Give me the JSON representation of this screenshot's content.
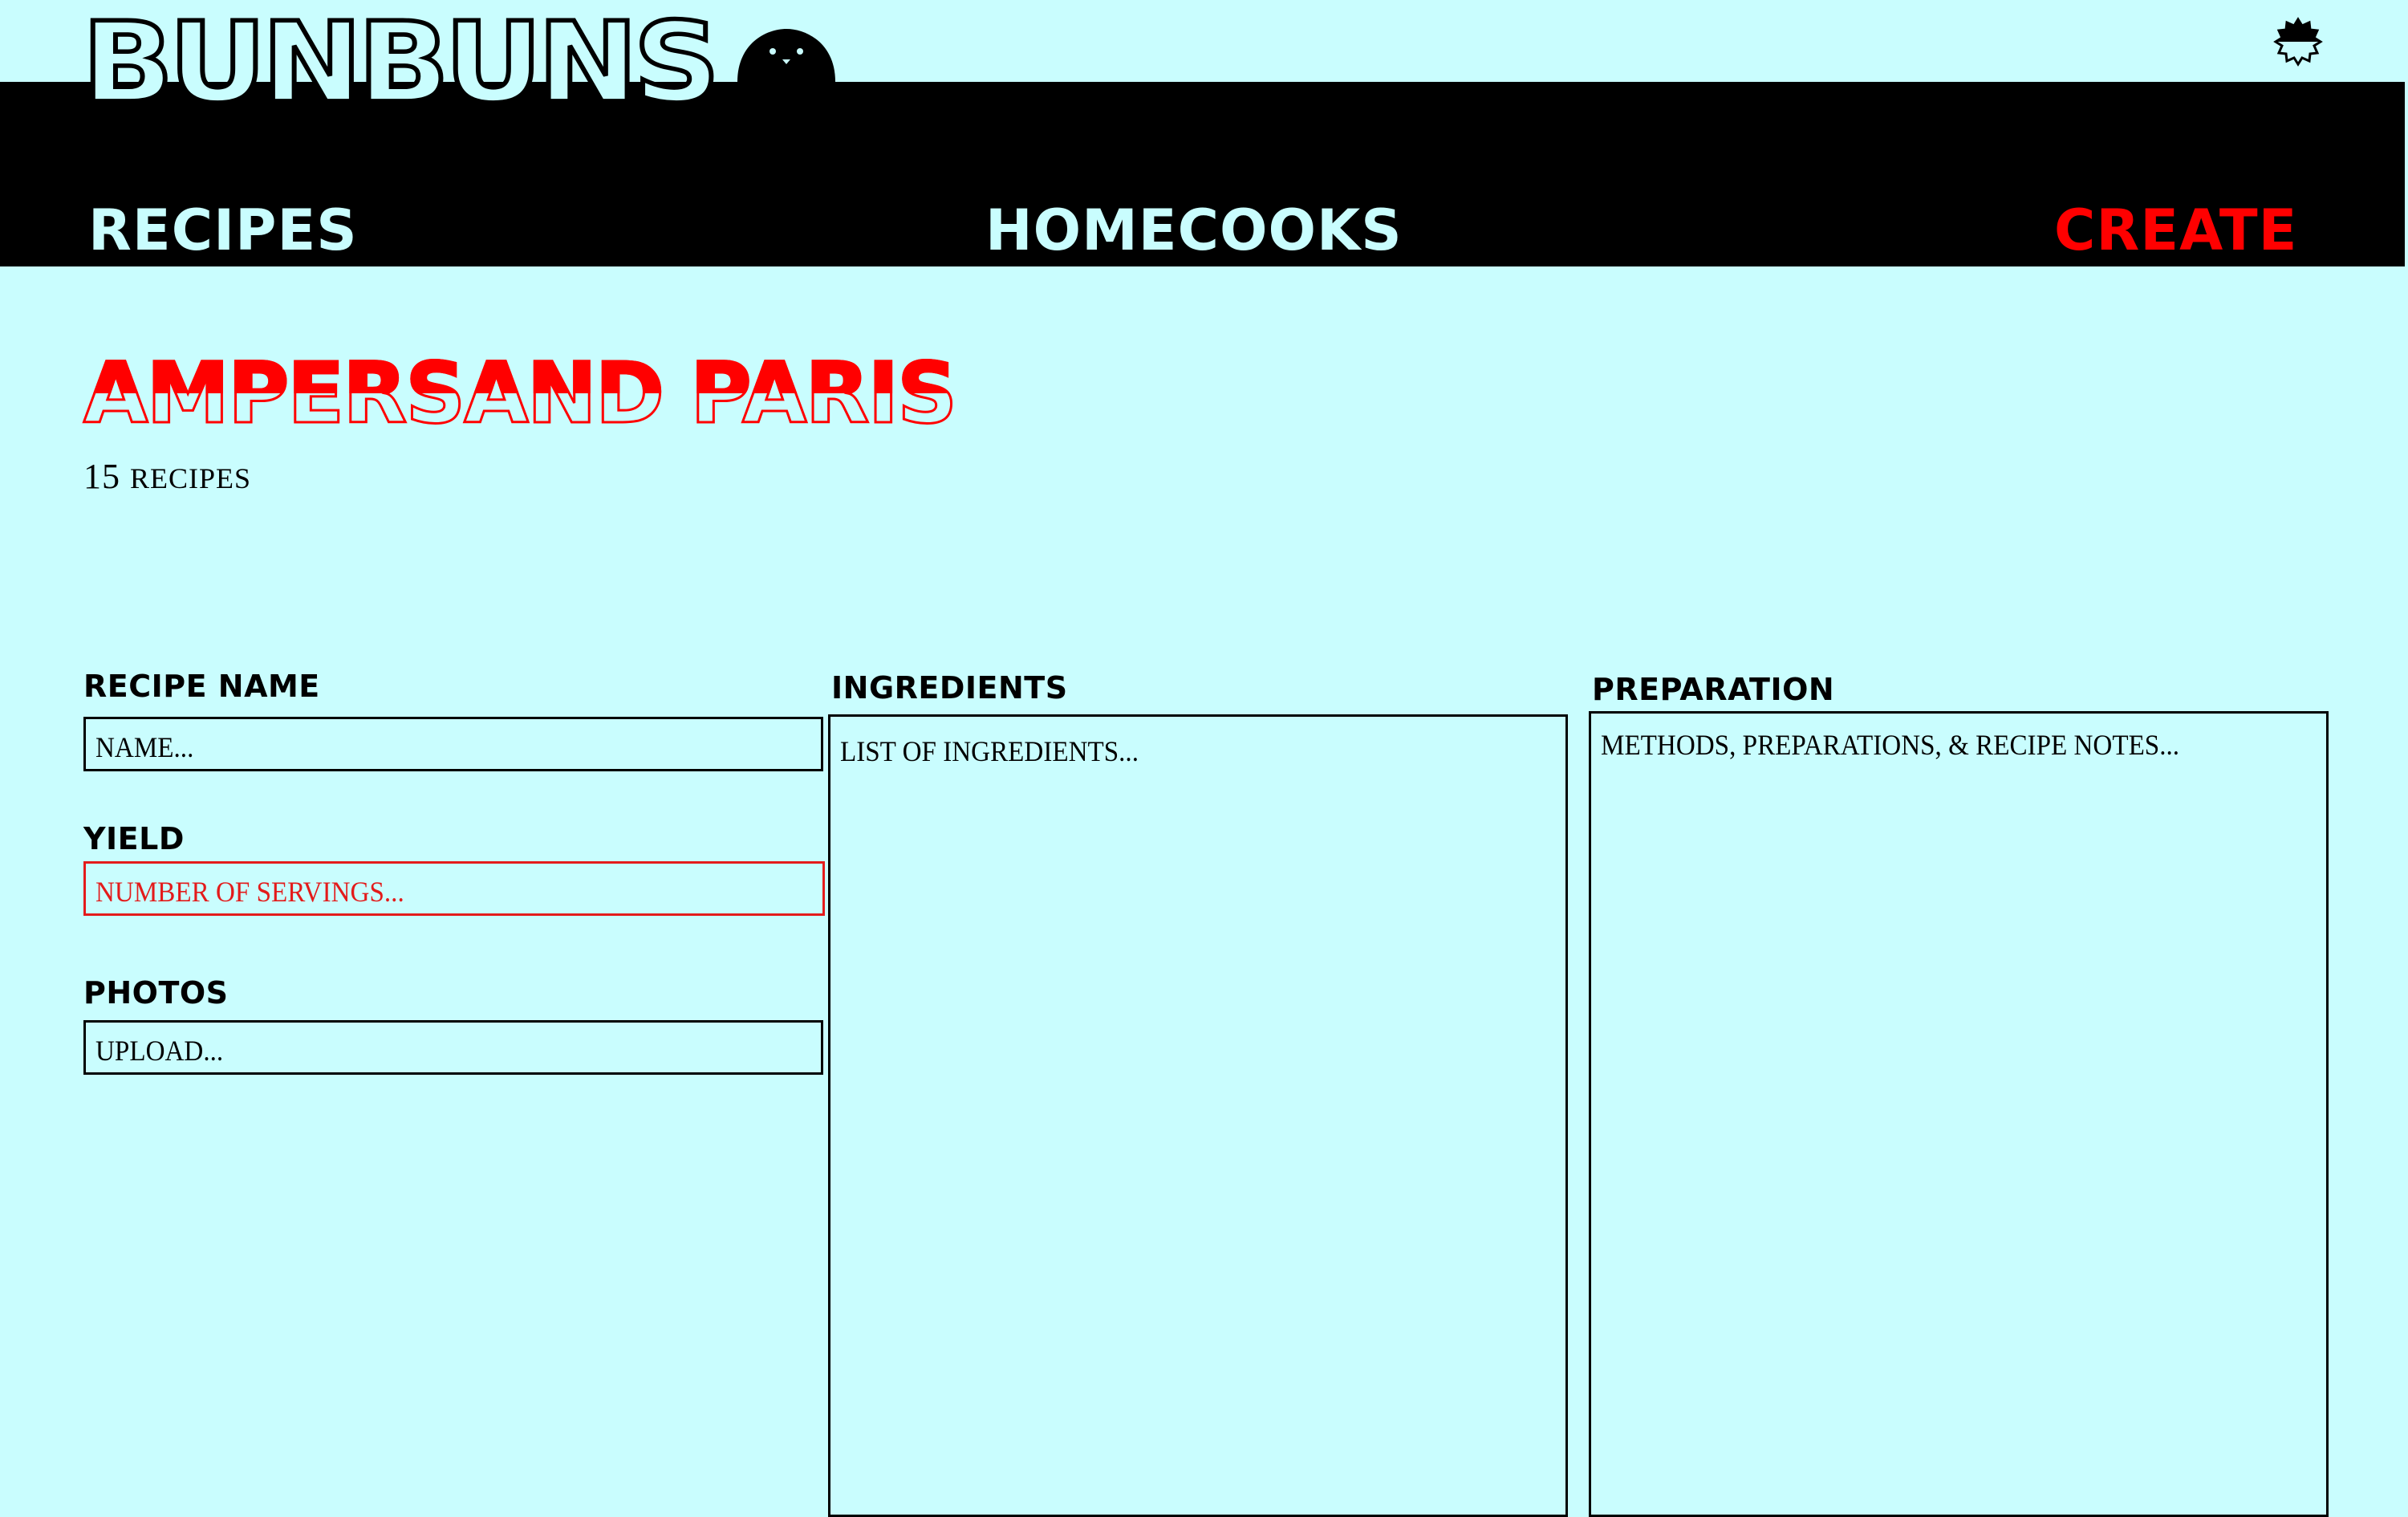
{
  "brand": {
    "name": "BUNBUNS"
  },
  "nav": {
    "recipes": "RECIPES",
    "homecooks": "HOMECOOKS",
    "create": "CREATE"
  },
  "profile": {
    "name": "AMPERSAND PARIS",
    "recipe_count": "15",
    "recipe_count_unit": "RECIPES"
  },
  "form": {
    "recipe_name": {
      "label": "RECIPE NAME",
      "placeholder": "NAME..."
    },
    "yield": {
      "label": "YIELD",
      "placeholder": "NUMBER OF SERVINGS...",
      "state": "error"
    },
    "photos": {
      "label": "PHOTOS",
      "placeholder": "UPLOAD..."
    },
    "ingredients": {
      "label": "INGREDIENTS",
      "placeholder": "LIST OF INGREDIENTS..."
    },
    "preparation": {
      "label": "PREPARATION",
      "placeholder": "METHODS, PREPARATIONS, & RECIPE NOTES..."
    }
  },
  "icons": {
    "logo": "burger-bun-icon",
    "settings": "settings-badge-icon"
  },
  "colors": {
    "background": "#c9fdfe",
    "nav_bar": "#000000",
    "accent": "#ff0000",
    "error": "#e31b1b"
  }
}
